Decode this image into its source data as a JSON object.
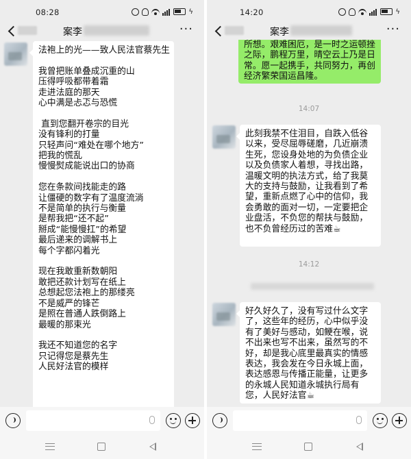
{
  "left": {
    "status_time": "08:28",
    "title": "案李",
    "message_lines": [
      "法袍上的光——致人民法官蔡先生",
      "",
      "我曾把账单叠成沉重的山",
      "压得呼吸都带着霜",
      "走进法庭的那天",
      "心中满是忐忑与恐慌",
      "",
      " 直到您翻开卷宗的目光",
      "没有锋利的打量",
      "只轻声问“难处在哪个地方”",
      "把我的慌乱",
      "慢慢熨成能说出口的协商",
      "",
      "您在条款间找能走的路",
      "让僵硬的数字有了温度流淌",
      "不是简单的执行与衡量",
      "是帮我把“还不起”",
      "掰成“能慢慢扛”的希望",
      "最后递来的调解书上",
      "每个字都闪着光",
      "",
      "现在我敢重新数朝阳",
      "敢把还款计划写在纸上",
      "总想起您法袍上的那缕亮",
      "不是威严的锋芒",
      "是照在普通人跌倒路上",
      "最暖的那束光",
      "",
      "我还不知道您的名字",
      "只记得您是蔡先生",
      "人民好法官的模样"
    ]
  },
  "right": {
    "status_time": "14:20",
    "title": "案李",
    "green_lines": [
      "所想。艰难困厄，是一时之运顿挫",
      "之际，鹏程万里，晴空云上乃是日",
      "常。愿一起携手，共同努力，再创",
      "经济繁荣国运昌隆。"
    ],
    "timestamp1": "14:07",
    "message2": "此刻我禁不住泪目，自跌入低谷以来，受尽屈辱磋磨，几近崩溃生死，您设身处地的为负债企业以及负债家人着想，寻找出路，温暖文明的执法方式，给了我莫大的支持与鼓励，让我看到了希望，重新点燃了心中的信仰，我会勇敢的面对一切，一定要把企业盘活，不负您的帮扶与鼓励，也不负曾经历过的苦难☕",
    "timestamp2": "14:12",
    "message3": "好久好久了，没有写过什么文字了，这些年的经历，心中似乎没有了美好与感动，如鲠在喉，说不出来也写不出来，虽然写的不好，却是我心底里最真实的情感表达，我会发在今日永城上面，表达感恩与传播正能量，让更多的永城人民知道永城执行局有您，人民好法官☕"
  },
  "status_badge": "5G"
}
